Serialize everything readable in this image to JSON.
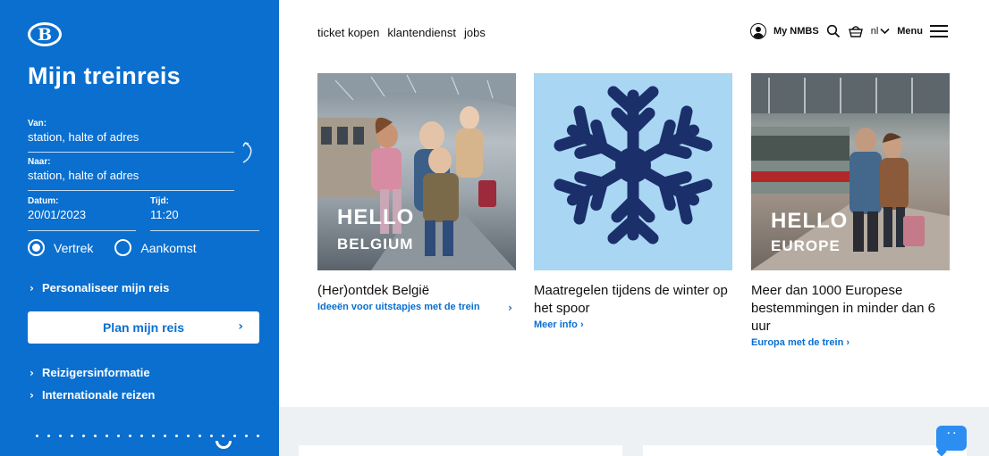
{
  "sidebar": {
    "logo": "B",
    "title": "Mijn treinreis",
    "from": {
      "label": "Van:",
      "placeholder": "station, halte of adres"
    },
    "to": {
      "label": "Naar:",
      "placeholder": "station, halte of adres"
    },
    "date": {
      "label": "Datum:",
      "value": "20/01/2023"
    },
    "time": {
      "label": "Tijd:",
      "value": "11:20"
    },
    "radio_departure": "Vertrek",
    "radio_arrival": "Aankomst",
    "personalize": "Personaliseer mijn reis",
    "plan_button": "Plan mijn reis",
    "links": [
      "Reizigersinformatie",
      "Internationale reizen"
    ]
  },
  "topnav": {
    "items": [
      "ticket kopen",
      "klantendienst",
      "jobs"
    ]
  },
  "utility": {
    "account": "My NMBS",
    "language": "nl",
    "menu": "Menu"
  },
  "cards": [
    {
      "headline": "(Her)ontdek België",
      "sub": "Ideeën voor uitstapjes met de trein",
      "overlay_title": "HELLO",
      "overlay_sub": "BELGIUM"
    },
    {
      "headline": "Maatregelen tijdens de winter op het spoor",
      "sub": "Meer info ›"
    },
    {
      "headline": "Meer dan 1000 Europese bestemmingen in minder dan 6 uur",
      "sub": "Europa met de trein ›",
      "overlay_title": "HELLO",
      "overlay_sub": "EUROPE"
    }
  ],
  "colors": {
    "brand_blue": "#0a6fcf",
    "snow_bg": "#a9d6f2",
    "snow_flake": "#1b2f6b",
    "band": "#edf1f3"
  }
}
